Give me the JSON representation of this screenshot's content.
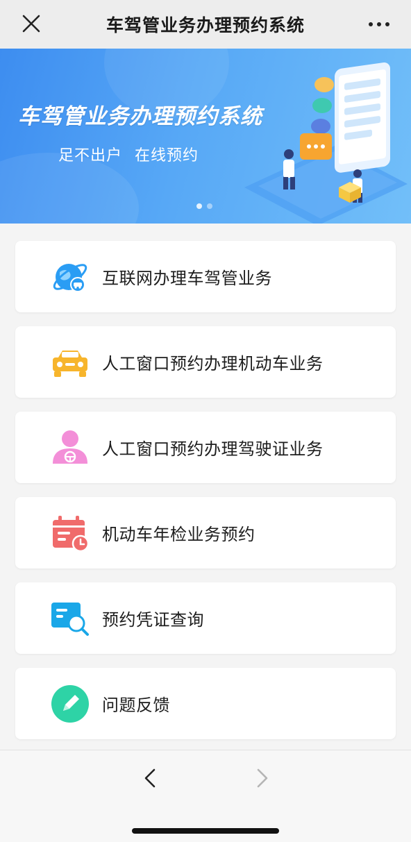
{
  "nav": {
    "title": "车驾管业务办理预约系统",
    "close_icon": "close-icon",
    "more_icon": "more-icon"
  },
  "banner": {
    "title": "车驾管业务办理预约系统",
    "subtitle": "足不出户  在线预约",
    "slide_count": 2,
    "active_slide": 1
  },
  "menu": {
    "items": [
      {
        "label": "互联网办理车驾管业务",
        "icon": "globe-car-icon",
        "color": "#2a9df4"
      },
      {
        "label": "人工窗口预约办理机动车业务",
        "icon": "car-icon",
        "color": "#f7b52c"
      },
      {
        "label": "人工窗口预约办理驾驶证业务",
        "icon": "person-icon",
        "color": "#f38fd8"
      },
      {
        "label": "机动车年检业务预约",
        "icon": "calendar-clock-icon",
        "color": "#f06b6b"
      },
      {
        "label": "预约凭证查询",
        "icon": "document-search-icon",
        "color": "#1aa7e8"
      },
      {
        "label": "问题反馈",
        "icon": "pencil-icon",
        "color": "#2ed3a6"
      }
    ]
  },
  "toolbar": {
    "back_icon": "chevron-left-icon",
    "forward_icon": "chevron-right-icon"
  }
}
